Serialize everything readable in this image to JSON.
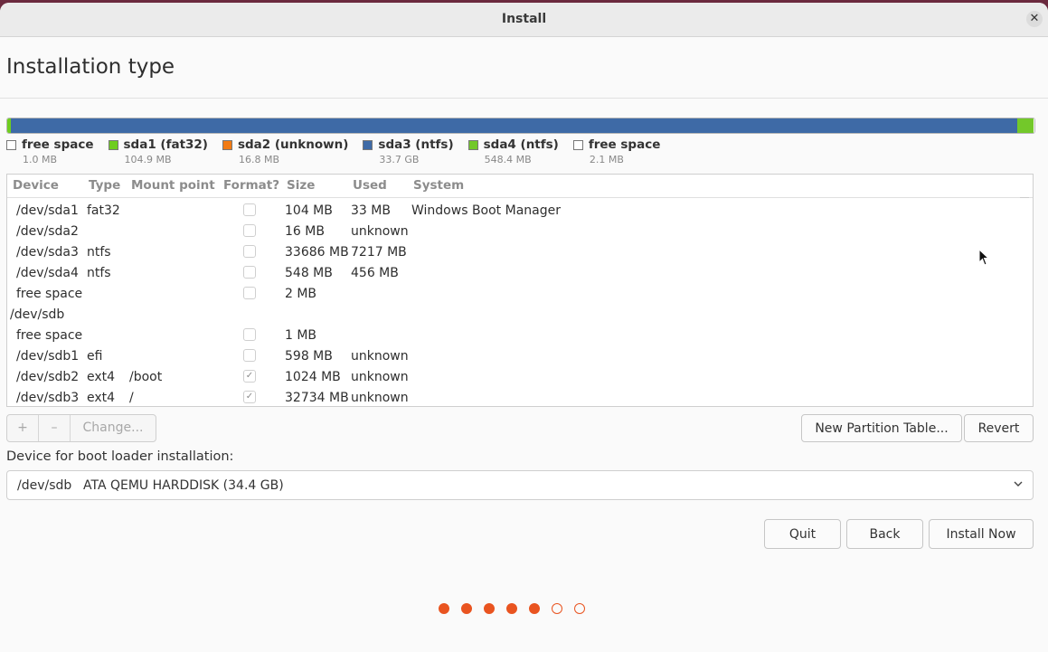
{
  "window": {
    "title": "Install"
  },
  "page": {
    "title": "Installation type"
  },
  "colors": {
    "accent": "#e95420",
    "free": "#ffffff",
    "fat32": "#6fcd1f",
    "unknown": "#f27b13",
    "ntfs": "#3e6aa6",
    "ntfs_green": "#73c82a"
  },
  "partition_bar": [
    {
      "label": "free space",
      "size": "1.0 MB",
      "color": "#ffffff",
      "share": 0.0003
    },
    {
      "label": "sda1 (fat32)",
      "size": "104.9 MB",
      "color": "#6fcd1f",
      "share": 0.003
    },
    {
      "label": "sda2 (unknown)",
      "size": "16.8 MB",
      "color": "#f27b13",
      "share": 0.0005
    },
    {
      "label": "sda3 (ntfs)",
      "size": "33.7 GB",
      "color": "#3e6aa6",
      "share": 0.98
    },
    {
      "label": "sda4 (ntfs)",
      "size": "548.4 MB",
      "color": "#73c82a",
      "share": 0.016
    },
    {
      "label": "free space",
      "size": "2.1 MB",
      "color": "#ffffff",
      "share": 0.0006
    }
  ],
  "table": {
    "headers": [
      "Device",
      "Type",
      "Mount point",
      "Format?",
      "Size",
      "Used",
      "System"
    ],
    "rows": [
      {
        "device": "/dev/sda1",
        "type": "fat32",
        "mount": "",
        "format": "unchecked",
        "size": "104 MB",
        "used": "33 MB",
        "system": "Windows Boot Manager",
        "indent": true
      },
      {
        "device": "/dev/sda2",
        "type": "",
        "mount": "",
        "format": "unchecked",
        "size": "16 MB",
        "used": "unknown",
        "system": "",
        "indent": true
      },
      {
        "device": "/dev/sda3",
        "type": "ntfs",
        "mount": "",
        "format": "unchecked",
        "size": "33686 MB",
        "used": "7217 MB",
        "system": "",
        "indent": true
      },
      {
        "device": "/dev/sda4",
        "type": "ntfs",
        "mount": "",
        "format": "unchecked",
        "size": "548 MB",
        "used": "456 MB",
        "system": "",
        "indent": true
      },
      {
        "device": "free space",
        "type": "",
        "mount": "",
        "format": "unchecked",
        "size": "2 MB",
        "used": "",
        "system": "",
        "indent": true
      },
      {
        "device": "/dev/sdb",
        "type": "",
        "mount": "",
        "format": "none",
        "size": "",
        "used": "",
        "system": "",
        "indent": false
      },
      {
        "device": "free space",
        "type": "",
        "mount": "",
        "format": "unchecked",
        "size": "1 MB",
        "used": "",
        "system": "",
        "indent": true
      },
      {
        "device": "/dev/sdb1",
        "type": "efi",
        "mount": "",
        "format": "unchecked",
        "size": "598 MB",
        "used": "unknown",
        "system": "",
        "indent": true
      },
      {
        "device": "/dev/sdb2",
        "type": "ext4",
        "mount": "/boot",
        "format": "checked",
        "size": "1024 MB",
        "used": "unknown",
        "system": "",
        "indent": true
      },
      {
        "device": "/dev/sdb3",
        "type": "ext4",
        "mount": "/",
        "format": "checked",
        "size": "32734 MB",
        "used": "unknown",
        "system": "",
        "indent": true
      }
    ]
  },
  "toolbar": {
    "add_label": "+",
    "remove_label": "–",
    "change_label": "Change...",
    "new_table_label": "New Partition Table...",
    "revert_label": "Revert"
  },
  "bootloader": {
    "label": "Device for boot loader installation:",
    "device": "/dev/sdb",
    "description": "ATA QEMU HARDDISK (34.4 GB)"
  },
  "nav": {
    "quit_label": "Quit",
    "back_label": "Back",
    "install_label": "Install Now"
  },
  "progress": {
    "steps_total": 7,
    "steps_done": 5
  }
}
